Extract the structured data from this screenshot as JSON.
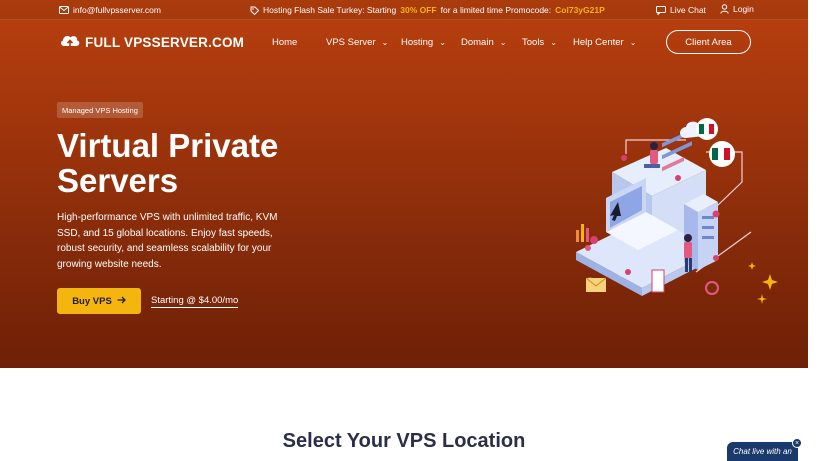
{
  "topbar": {
    "email": "info@fullvpsserver.com",
    "promo_prefix": "Hosting Flash Sale Turkey: Starting",
    "promo_discount": "30% OFF",
    "promo_middle": "for a limited time Promocode:",
    "promo_code": "Col73yG21P",
    "live_chat": "Live Chat",
    "login": "Login"
  },
  "nav": {
    "logo_text": "FULL VPSSERVER.COM",
    "items": [
      {
        "label": "Home"
      },
      {
        "label": "VPS Server"
      },
      {
        "label": "Hosting"
      },
      {
        "label": "Domain"
      },
      {
        "label": "Tools"
      },
      {
        "label": "Help Center"
      }
    ],
    "client_area": "Client Area"
  },
  "hero": {
    "badge": "Managed VPS Hosting",
    "title_line1": "Virtual Private",
    "title_line2": "Servers",
    "description": "High-performance VPS with unlimited traffic, KVM SSD, and 15 global locations. Enjoy fast speeds, robust security, and seamless scalability for your growing website needs.",
    "buy_button": "Buy VPS",
    "starting_link": "Starting @ $4.00/mo"
  },
  "section": {
    "title": "Select Your VPS Location"
  },
  "chat_widget": {
    "label": "Chat live with an",
    "close": "×"
  },
  "colors": {
    "accent": "#f5b50f",
    "hero_top": "#b9400f",
    "hero_bottom": "#6e2006",
    "chat_bg": "#1a3a6b"
  },
  "icons": {
    "email": "mail-icon",
    "promo": "tag-icon",
    "live_chat": "chat-icon",
    "login": "user-icon",
    "logo": "cloud-upload-icon",
    "buy": "arrow-right-icon"
  }
}
